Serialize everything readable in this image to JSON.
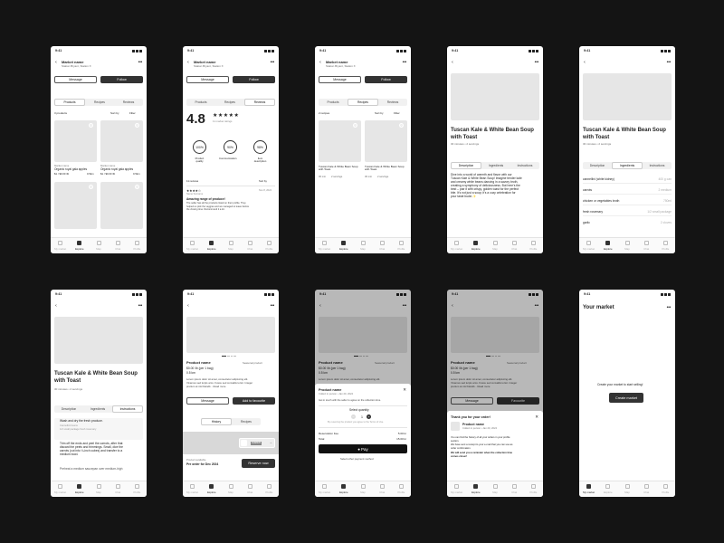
{
  "status": {
    "time": "9:41"
  },
  "nav": [
    "My market",
    "Explore",
    "Map",
    "Chat",
    "Profile"
  ],
  "market": {
    "name": "Market name",
    "location": "Station Bryant, Station X",
    "message": "Message",
    "follow": "Follow",
    "tabs": [
      "Products",
      "Recipes",
      "Reviews"
    ],
    "sort": "Sort by",
    "filter": "Filter",
    "products_count": "3 products",
    "product1": {
      "market": "Market name",
      "name": "Organic royal gala apples",
      "price": "$1 / $0.00 /lb",
      "dist": "0.5km"
    },
    "product2": {
      "market": "Market name",
      "name": "Organic royal gala apples",
      "price": "$1 / $0.00 /lb",
      "dist": "0.5km"
    },
    "recipes_count": "2 recipes",
    "recipe1": {
      "name": "Tuscan Kale & White Bean Soup with Toast",
      "meta1": "30 min",
      "meta2": "2 servings"
    },
    "recipe2": {
      "name": "Tuscan Kale & White Bean Soup with Toast",
      "meta1": "30 min",
      "meta2": "2 servings"
    }
  },
  "reviews": {
    "rating": "4.8",
    "stars": "★★★★★",
    "count": "11 market ratings",
    "m1": {
      "value": "100%",
      "label": "Product quality"
    },
    "m2": {
      "value": "90%",
      "label": "Communication"
    },
    "m3": {
      "value": "98%",
      "label": "Item description"
    },
    "reviews_count": "11 reviews",
    "r_stars": "★★★★☆",
    "r_name": "Name Surname",
    "r_date": "Nov 8, 2024",
    "r_title": "Amazing range of produce!",
    "r_body1": "The seller has all the products listed on their profile. They",
    "r_body2": "helped us pick the veggies and we managed to leave before",
    "r_body3": "the closing time. Recommend it a lot."
  },
  "recipe": {
    "title1": "Tuscan Kale & White Bean Soup",
    "title2": "with Toast",
    "meta": "30 minutes • 2 servings",
    "tabs": [
      "Description",
      "Ingredients",
      "Instructions"
    ],
    "desc": [
      "Dive into a world of warmth and flavor with our",
      "Tuscan Kale & White Bean Soup! Imagine tender kale",
      "and creamy white beans dancing in a savory broth,",
      "creating a symphony of deliciousness. But here's the",
      "best – pair it with crispy, golden toast for the perfect",
      "bite. It's not just a soup; it's a cozy celebration for",
      "your taste buds! ✨"
    ],
    "ingredients": [
      {
        "name": "cannellini (white kidney)",
        "qty": "400 g can"
      },
      {
        "name": "carrots",
        "qty": "2 medium"
      },
      {
        "name": "chicken or vegetables broth",
        "qty": "750ml"
      },
      {
        "name": "fresh rosemary",
        "qty": "1/2 small package"
      },
      {
        "name": "garlic",
        "qty": "2 cloves"
      }
    ],
    "steps": [
      {
        "l1": "Wash and dry the fresh produce.",
        "l2": "Cannellini beans",
        "l3": "1/2 small package fresh rosemary"
      },
      {
        "l1": "Trim off the ends and peel the carrots, after that",
        "l2": "discard the peels and trimmings. Small, dice the",
        "l3": "carrots (cut into ¼-inch cubes) and transfer to a",
        "l4": "medium bowl."
      },
      {
        "l1": "Preheat a medium saucepan over medium-high"
      }
    ]
  },
  "product": {
    "name": "Product name",
    "save": "Seasonal product",
    "price": "$0.00 /lb (per 1 bag)",
    "dist": "0.5 km",
    "desc1": "Lorem ipsum dolor sit amet, consectetur adipiscing elit.",
    "desc2": "Vivamus sed turpis arcu. Fusce sed convallis tortor. Integer",
    "desc3": "pretium at nisl blandit... Read more",
    "message": "Message",
    "add_fav": "Add to favourite",
    "fav": "Favourite",
    "tabs": [
      "History",
      "Recipes"
    ],
    "market_label": "Market",
    "avail": "Product available",
    "preorder": "Pre order for Dec 2024",
    "reserve": "Reserve now"
  },
  "reserve_sheet": {
    "title": "Product name",
    "collect": "Collect in person • Jan 20, 2024",
    "hint": "Get in touch with the seller to agree on the collection time.",
    "select": "Select quantity",
    "qty": "1",
    "note": "By reserving the product you agree to the Terms of Use.",
    "fee_label": "Reservation Fee",
    "fee": "5.00 kr",
    "total_label": "Total",
    "total": "15.00 kr",
    "pay": "Pay",
    "other": "Select other payment method"
  },
  "thanks_sheet": {
    "title": "Thank you for your order!",
    "product": "Product name",
    "collect": "Collect in person • Jan 20, 2024",
    "t1": "You can find the history of all your orders in your profile",
    "t2": "section.",
    "t3": "We have sent a receipt to your e-mail that you can use as",
    "t4": "order confirmation.",
    "t5": "We will send you a reminder when the collection time",
    "t6": "comes closer!"
  },
  "empty": {
    "title": "Your market",
    "text": "Create your market to start selling!",
    "cta": "Create market"
  }
}
